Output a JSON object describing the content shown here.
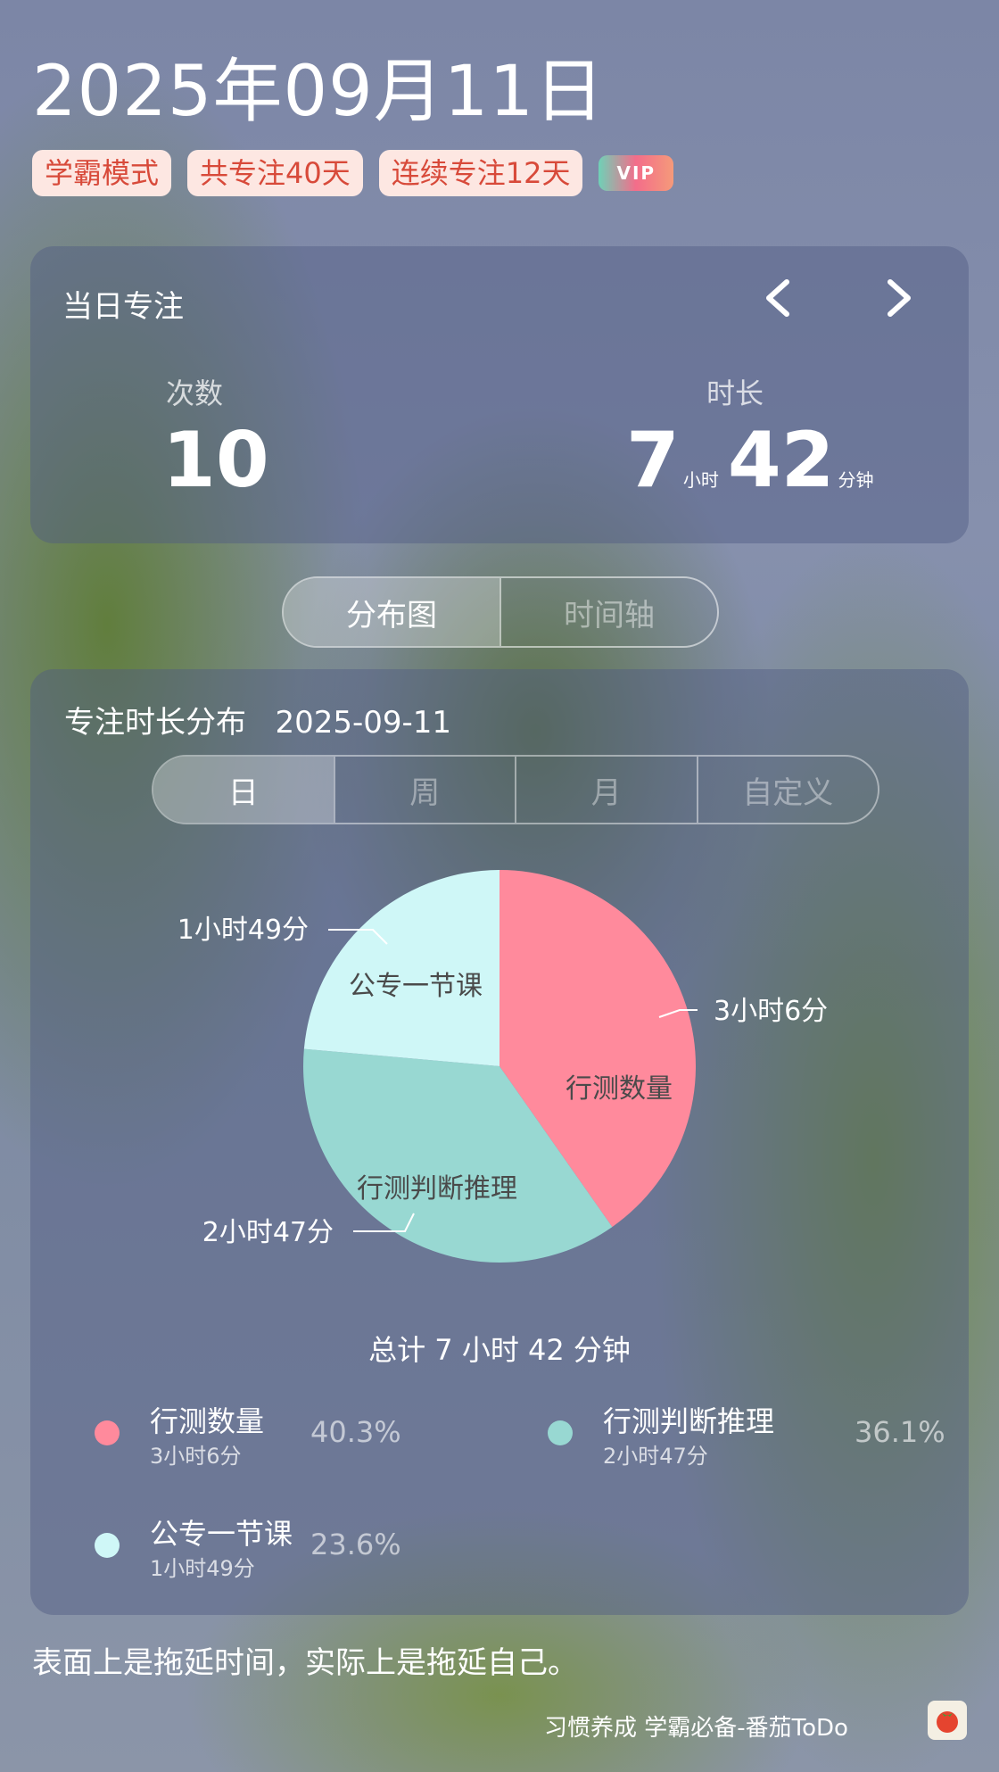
{
  "header": {
    "date": "2025年09月11日",
    "badges": [
      "学霸模式",
      "共专注40天",
      "连续专注12天"
    ],
    "vip": "VIP"
  },
  "daily": {
    "title": "当日专注",
    "count_label": "次数",
    "count_value": "10",
    "duration_label": "时长",
    "hours": "7",
    "hours_unit": "小时",
    "minutes": "42",
    "minutes_unit": "分钟"
  },
  "view_toggle": {
    "distribution": "分布图",
    "timeline": "时间轴",
    "selected": "分布图"
  },
  "distribution": {
    "title": "专注时长分布",
    "date": "2025-09-11",
    "tabs": [
      "日",
      "周",
      "月",
      "自定义"
    ],
    "selected_tab": "日",
    "total": "总计 7 小时 42 分钟"
  },
  "chart_data": {
    "type": "pie",
    "slices": [
      {
        "name": "行测数量",
        "duration": "3小时6分",
        "minutes": 186,
        "percent": "40.3%",
        "color": "#ff8a9c"
      },
      {
        "name": "行测判断推理",
        "duration": "2小时47分",
        "minutes": 167,
        "percent": "36.1%",
        "color": "#98d8d2"
      },
      {
        "name": "公专一节课",
        "duration": "1小时49分",
        "minutes": 109,
        "percent": "23.6%",
        "color": "#cff7f7"
      }
    ],
    "callouts": [
      "3小时6分",
      "2小时47分",
      "1小时49分"
    ]
  },
  "quote": "表面上是拖延时间，实际上是拖延自己。",
  "footer": "习惯养成 学霸必备-番茄ToDo",
  "icons": {
    "prev": "chevron-left-icon",
    "next": "chevron-right-icon",
    "logo": "tomato-icon"
  }
}
